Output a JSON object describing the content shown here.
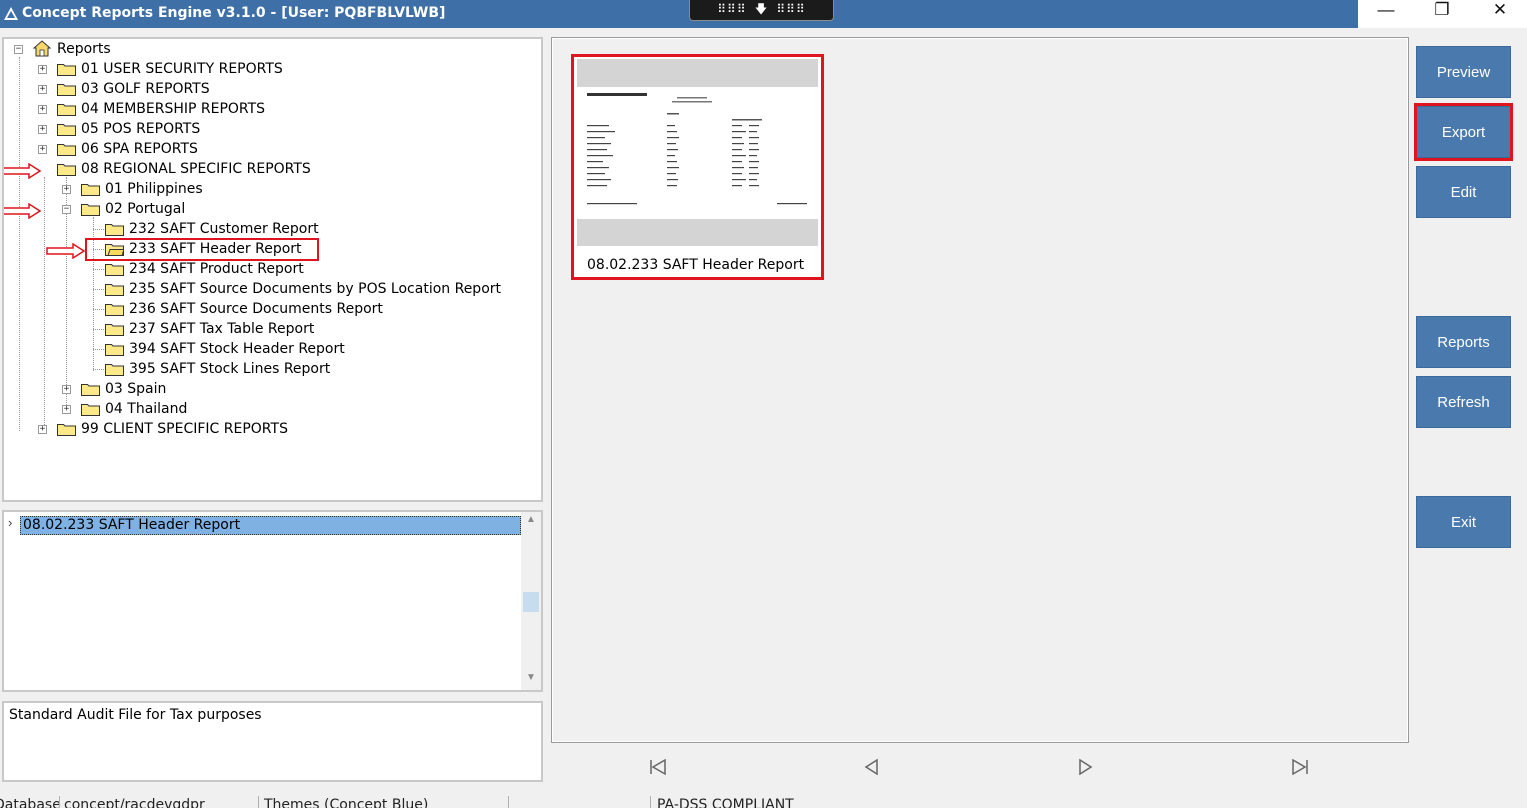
{
  "window": {
    "title": "Concept Reports Engine v3.1.0 - [User: PQBFBLVLWB]",
    "grip": "⠿⠿⠿ 🡇 ⠿⠿⠿",
    "minimize": "—",
    "restore": "❐",
    "close": "✕"
  },
  "tree": {
    "root": "Reports",
    "items": [
      {
        "label": "01 USER SECURITY REPORTS"
      },
      {
        "label": "03 GOLF REPORTS"
      },
      {
        "label": "04 MEMBERSHIP REPORTS"
      },
      {
        "label": "05 POS REPORTS"
      },
      {
        "label": "06 SPA REPORTS"
      },
      {
        "label": "08 REGIONAL SPECIFIC REPORTS"
      },
      {
        "label": "01 Philippines"
      },
      {
        "label": "02 Portugal"
      },
      {
        "label": "232 SAFT Customer Report"
      },
      {
        "label": "233 SAFT Header Report"
      },
      {
        "label": "234 SAFT Product Report"
      },
      {
        "label": "235 SAFT Source Documents by POS Location Report"
      },
      {
        "label": "236 SAFT Source Documents Report"
      },
      {
        "label": "237 SAFT Tax Table Report"
      },
      {
        "label": "394 SAFT Stock Header Report"
      },
      {
        "label": "395 SAFT Stock Lines Report"
      },
      {
        "label": "03 Spain"
      },
      {
        "label": "04 Thailand"
      },
      {
        "label": "99 CLIENT SPECIFIC REPORTS"
      }
    ]
  },
  "report_list": {
    "selected": "08.02.233 SAFT Header Report"
  },
  "description": "Standard Audit File for Tax purposes",
  "preview": {
    "thumbnail_caption": "08.02.233 SAFT Header Report"
  },
  "buttons": {
    "preview": "Preview",
    "export": "Export",
    "edit": "Edit",
    "reports": "Reports",
    "refresh": "Refresh",
    "exit": "Exit"
  },
  "nav": {
    "first": "first-page-icon",
    "prev": "previous-page-icon",
    "next": "next-page-icon",
    "last": "last-page-icon"
  },
  "status": {
    "database": "Database",
    "connection": "concept/racdevgdpr",
    "theme": "Themes (Concept Blue)",
    "compliance": "PA-DSS COMPLIANT"
  },
  "colors": {
    "titlebar": "#3e70a7",
    "button": "#4a7aad",
    "highlight": "#e0141e",
    "selection": "#7fb1e3"
  }
}
